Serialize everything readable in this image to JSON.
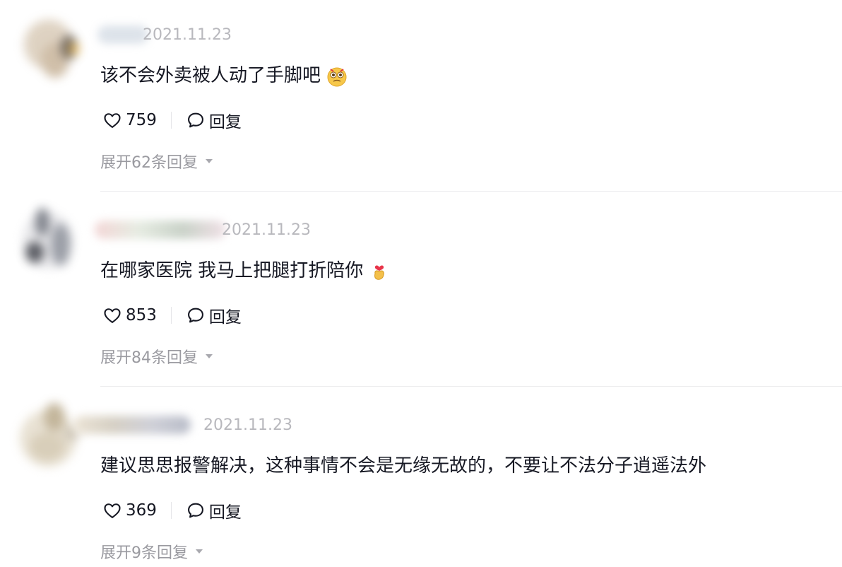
{
  "comments": [
    {
      "date": "2021.11.23",
      "text": "该不会外卖被人动了手脚吧",
      "emoji": "crying-face-emoji",
      "likes": "759",
      "reply_label": "回复",
      "expand_label": "展开62条回复"
    },
    {
      "date": "2021.11.23",
      "text": "在哪家医院 我马上把腿打折陪你",
      "emoji": "finger-heart-emoji",
      "likes": "853",
      "reply_label": "回复",
      "expand_label": "展开84条回复"
    },
    {
      "date": "2021.11.23",
      "text": "建议思思报警解决，这种事情不会是无缘无故的，不要让不法分子逍遥法外",
      "emoji": "",
      "likes": "369",
      "reply_label": "回复",
      "expand_label": "展开9条回复"
    }
  ],
  "icons": {
    "like": "heart-outline-icon",
    "reply": "speech-bubble-icon",
    "expand": "caret-down-icon"
  },
  "colors": {
    "text": "#161823",
    "muted": "#9a9aa0",
    "date": "#b8b8bd",
    "divider": "#ececee"
  }
}
